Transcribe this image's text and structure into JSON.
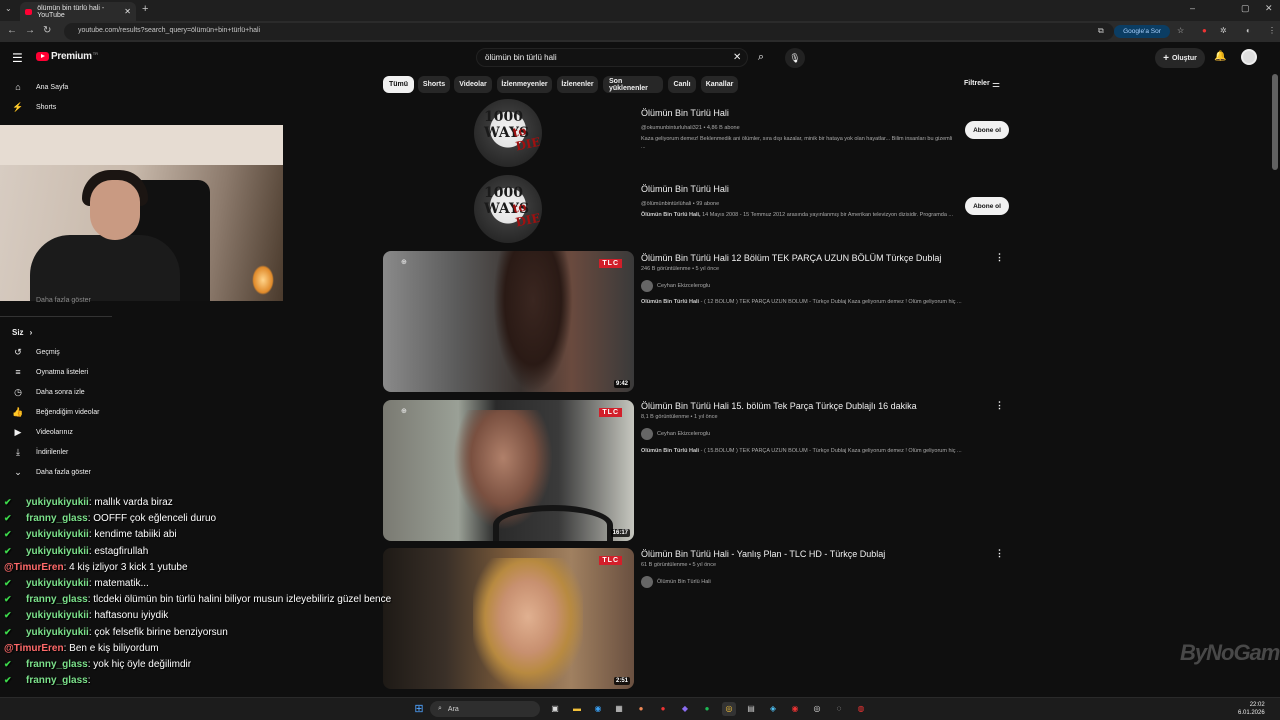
{
  "browser": {
    "tab_title": "ölümün bin türlü hali - YouTube",
    "url": "youtube.com/results?search_query=ölümün+bin+türlü+hali",
    "ask_google": "Google'a Sor"
  },
  "header": {
    "logo_text": "Premium",
    "logo_country": "TR",
    "search_value": "ölümün bin türlü hali",
    "create_label": "Oluştur"
  },
  "chips": [
    "Tümü",
    "Shorts",
    "Videolar",
    "İzlenmeyenler",
    "İzlenenler",
    "Son yüklenenler",
    "Canlı",
    "Kanallar"
  ],
  "filters_label": "Filtreler",
  "sidebar": {
    "top": [
      {
        "label": "Ana Sayfa",
        "icon": "home-icon"
      },
      {
        "label": "Shorts",
        "icon": "shorts-icon"
      }
    ],
    "hidden_partial": "Daha fazla göster",
    "you_label": "Siz",
    "you_items": [
      {
        "label": "Geçmiş",
        "icon": "history-icon"
      },
      {
        "label": "Oynatma listeleri",
        "icon": "playlist-icon"
      },
      {
        "label": "Daha sonra izle",
        "icon": "clock-icon"
      },
      {
        "label": "Beğendiğim videolar",
        "icon": "thumb-up-icon"
      },
      {
        "label": "Videolarınız",
        "icon": "video-icon"
      },
      {
        "label": "İndirilenler",
        "icon": "download-icon"
      },
      {
        "label": "Daha fazla göster",
        "icon": "chevron-down-icon"
      }
    ]
  },
  "channels": [
    {
      "title": "Ölümün Bin Türlü Hali",
      "meta": "@okumunbinturluhali321 • 4,86 B abone",
      "desc": "Kaza geliyorum demez! Beklenmedik ani ölümler, sıra dışı kazalar, minik bir hataya yok olan hayatlar... Bilim insanları bu gizemli ...",
      "subscribe": "Abone ol",
      "avatar_text_1": "1000 WAYS",
      "avatar_text_2": "to DIE"
    },
    {
      "title": "Ölümün Bin Türlü Hali",
      "meta": "@ölümünbintürlühali • 99 abone",
      "desc_bold": "Ölümün Bin Türlü Hali,",
      "desc": " 14 Mayıs 2008 - 15 Temmuz 2012 arasında yayınlanmış bir Amerikan televizyon dizisidir. Programda ...",
      "subscribe": "Abone ol",
      "avatar_text_1": "1000 WAYS",
      "avatar_text_2": "to DIE"
    }
  ],
  "videos": [
    {
      "title": "Ölümün Bin Türlü Hali 12 Bölüm TEK PARÇA UZUN BÖLÜM Türkçe Dublaj",
      "meta": "246 B görüntülenme • 5 yıl önce",
      "channel": "Ceyhan Ekizceleroglu",
      "desc_bold": "Ölümün Bin Türlü Hali",
      "desc": " - ( 12 BÖLÜM ) TEK PARÇA UZUN BÖLÜM - Türkçe Dublaj Kaza geliyorum demez ! Ölüm geliyorum hiç ...",
      "duration": "9:42",
      "tlc": "TLC"
    },
    {
      "title": "Ölümün Bin Türlü Hali 15. bölüm Tek Parça Türkçe Dublajlı 16 dakika",
      "meta": "8,1 B görüntülenme • 1 yıl önce",
      "channel": "Ceyhan Ekizceleroglu",
      "desc_bold": "Ölümün Bin Türlü Hali",
      "desc": " - ( 15.BÖLÜM ) TEK PARÇA UZUN BÖLÜM - Türkçe Dublaj Kaza geliyorum demez ! Ölüm geliyorum hiç ...",
      "duration": "16:17",
      "tlc": "TLC"
    },
    {
      "title": "Ölümün Bin Türlü Hali - Yanlış Plan - TLC HD - Türkçe Dublaj",
      "meta": "61 B görüntülenme • 5 yıl önce",
      "channel": "Ölümün Bin Türlü Hali",
      "duration": "2:51",
      "tlc": "TLC"
    }
  ],
  "chat": [
    {
      "user": "yukiyukiyukii",
      "msg": ": mallık varda biraz",
      "color": "green"
    },
    {
      "user": "franny_glass",
      "msg": ": OOFFF çok eğlenceli duruo",
      "color": "green"
    },
    {
      "user": "yukiyukiyukii",
      "msg": ": kendime tabiiki abi",
      "color": "green"
    },
    {
      "user": "yukiyukiyukii",
      "msg": ": estagfirullah",
      "color": "green"
    },
    {
      "user": "@TimurEren",
      "msg": ": 4 kiş izliyor 3 kick 1 yutube",
      "color": "red"
    },
    {
      "user": "yukiyukiyukii",
      "msg": ": matematik...",
      "color": "green"
    },
    {
      "user": "franny_glass",
      "msg": ": tlcdeki ölümün bin türlü halini biliyor musun izleyebiliriz güzel bence",
      "color": "green"
    },
    {
      "user": "yukiyukiyukii",
      "msg": ": haftasonu iyiydik",
      "color": "green"
    },
    {
      "user": "yukiyukiyukii",
      "msg": ": çok felsefik birine benziyorsun",
      "color": "green"
    },
    {
      "user": "@TimurEren",
      "msg": ": Ben e kiş biliyordum",
      "color": "red"
    },
    {
      "user": "franny_glass",
      "msg": ": yok hiç öyle değilimdir",
      "color": "green"
    },
    {
      "user": "franny_glass",
      "msg": ":",
      "color": "green"
    }
  ],
  "taskbar": {
    "search": "Ara",
    "time": "22:02",
    "date": "6.01.2026"
  },
  "watermark": "ByNoGame"
}
